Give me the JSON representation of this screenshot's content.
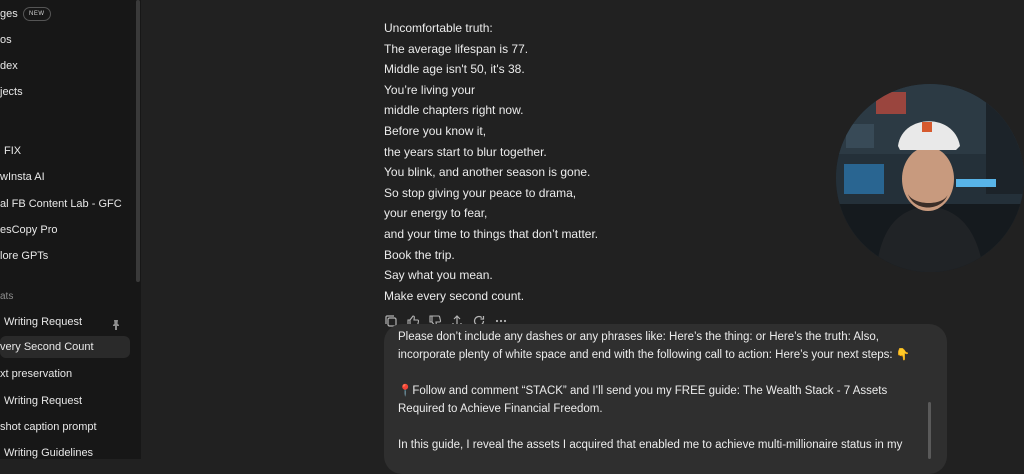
{
  "sidebar": {
    "items": [
      {
        "label": "ges",
        "badge": "NEW"
      },
      {
        "label": "os"
      },
      {
        "label": "dex"
      },
      {
        "label": "jects"
      }
    ],
    "gpts": [
      {
        "label": "FIX"
      },
      {
        "label": "wInsta AI"
      },
      {
        "label": "al FB Content Lab - GFC"
      },
      {
        "label": "esCopy Pro"
      },
      {
        "label": "lore GPTs"
      }
    ],
    "chats_heading": "ats",
    "chats": [
      {
        "label": "Writing Request",
        "pinned": true
      },
      {
        "label": "very Second Count",
        "active": true
      },
      {
        "label": "xt preservation"
      },
      {
        "label": "Writing Request"
      },
      {
        "label": "shot caption prompt"
      },
      {
        "label": "Writing Guidelines"
      }
    ]
  },
  "message": {
    "lines": [
      "Uncomfortable truth:",
      "The average lifespan is 77.",
      "Middle age isn't 50, it's 38.",
      "You’re living your",
      "middle chapters right now.",
      "Before you know it,",
      "the years start to blur together.",
      "You blink, and another season is gone.",
      "So stop giving your peace to drama,",
      "your energy to fear,",
      "and your time to things that don’t matter.",
      "Book the trip.",
      "Say what you mean.",
      "Make every second count."
    ],
    "action_icons": [
      "copy-icon",
      "thumbs-up-icon",
      "thumbs-down-icon",
      "share-icon",
      "regenerate-icon",
      "more-icon"
    ]
  },
  "user_message": {
    "para1": "Please don’t include any dashes or any phrases like:  Here’s the thing: or Here’s the truth:   Also, incorporate plenty of white space and end with the following call to action:  Here’s your next steps: 👇",
    "para2": "📍Follow and comment “STACK” and I’ll send you my FREE guide: The Wealth Stack - 7 Assets Required to Achieve Financial Freedom.",
    "para3": "In this guide, I reveal the assets I acquired that enabled me to achieve multi-millionaire status in my"
  },
  "colors": {
    "background": "#212121",
    "sidebar": "#171717",
    "bubble": "#2f2f2f",
    "text": "#ececec"
  }
}
